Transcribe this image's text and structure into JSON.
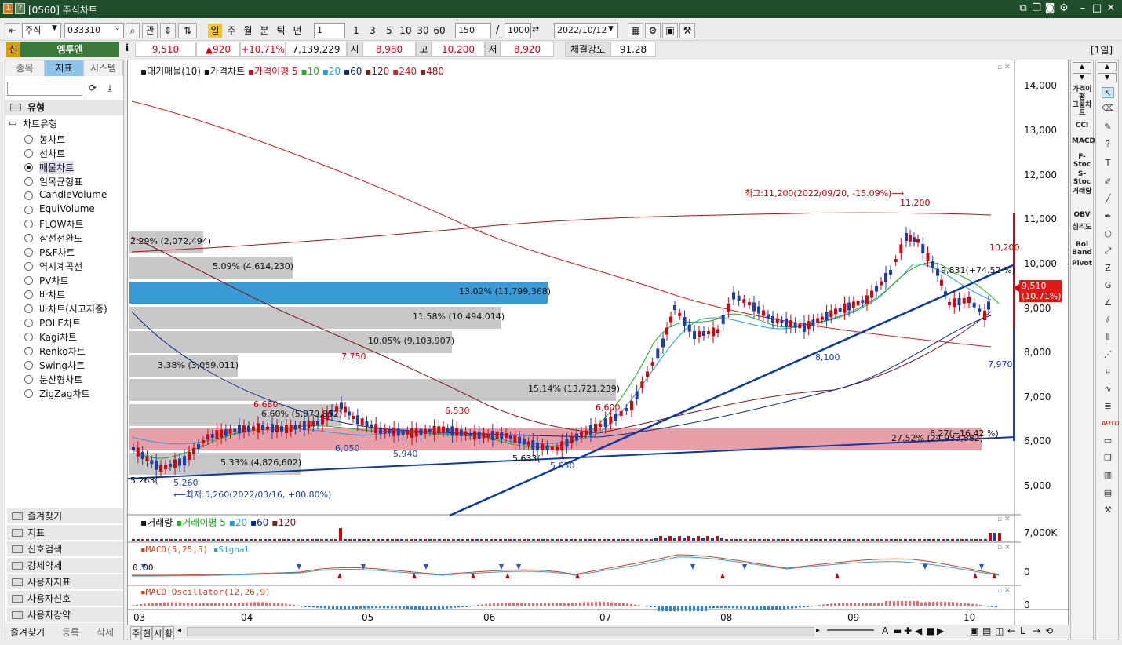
{
  "window": {
    "title": "[0560] 주식차트",
    "icons": [
      "1",
      "?"
    ]
  },
  "toolbar": {
    "market": "주식",
    "code": "033310",
    "related_btn": "관",
    "periods": [
      "일",
      "주",
      "월",
      "분",
      "틱",
      "년"
    ],
    "active_period": "일",
    "interval_select": "1",
    "minute_buttons": [
      "1",
      "3",
      "5",
      "10",
      "30",
      "60"
    ],
    "count": "150",
    "slash": "/",
    "max_count": "1000",
    "date": "2022/10/12"
  },
  "quote": {
    "flag": "신",
    "name": "엠투엔",
    "info_btn": "i",
    "price": "9,510",
    "change": "▲920",
    "rate": "+10.71%",
    "volume": "7,139,229",
    "open_label": "시",
    "open": "8,980",
    "high_label": "고",
    "high": "10,200",
    "low_label": "저",
    "low": "8,920",
    "strength_label": "체결강도",
    "strength": "91.28",
    "period_tag": "[1일]"
  },
  "left_panel": {
    "tabs": [
      "종목",
      "지표",
      "시스템"
    ],
    "active_tab": "지표",
    "section": "유형",
    "tree_root": "차트유형",
    "chart_types": [
      "봉차트",
      "선차트",
      "매물차트",
      "일목균형표",
      "CandleVolume",
      "EquiVolume",
      "FLOW차트",
      "삼선전환도",
      "P&F차트",
      "역시계곡선",
      "PV차트",
      "바차트",
      "바차트(시고저종)",
      "POLE차트",
      "Kagi차트",
      "Renko차트",
      "Swing차트",
      "분산형차트",
      "ZigZag차트"
    ],
    "selected_type": "매물차트",
    "groups": [
      "즐겨찾기",
      "지표",
      "신호검색",
      "강세약세",
      "사용자지표",
      "사용자신호",
      "사용자강약"
    ],
    "bottom_buttons": [
      "즐겨찾기",
      "등록",
      "삭제"
    ]
  },
  "chart": {
    "legend_main": {
      "vp": "대기매물(10)",
      "price": "가격차트",
      "ma_label": "가격이평 5",
      "ma": [
        "10",
        "20",
        "60",
        "120",
        "240",
        "480"
      ]
    },
    "y_labels": [
      "14,000",
      "13,000",
      "12,000",
      "11,000",
      "10,000",
      "9,000",
      "8,000",
      "7,000",
      "6,000",
      "5,000"
    ],
    "x_labels": [
      "03",
      "04",
      "05",
      "06",
      "07",
      "08",
      "09",
      "10"
    ],
    "volume_profile": [
      {
        "pct": "2.29% (2,072,494)"
      },
      {
        "pct": "5.09% (4,614,230)"
      },
      {
        "pct": "13.02% (11,799,368)"
      },
      {
        "pct": "11.58% (10,494,014)"
      },
      {
        "pct": "10.05% (9,103,907)"
      },
      {
        "pct": "3.38% (3,059,011)"
      },
      {
        "pct": "15.14% (13,721,239)"
      },
      {
        "pct": "6.60% (5,979,852)"
      },
      {
        "pct": "27.52% (24,933,882)"
      },
      {
        "pct": "5.33% (4,826,602)"
      }
    ],
    "annotations": {
      "high_note": "최고:11,200(2022/09/20, -15.09%)⟶",
      "low_note": "⟵최저:5,260(2022/03/16, +80.80%)",
      "p11200": "11,200",
      "p10200": "10,200",
      "p9831": "9,831(+74.52 %)",
      "p8100": "8,100",
      "p7970": "7,970",
      "p7750": "7,750",
      "p6680": "6,680",
      "p6530": "6,530",
      "p6600": "6,600",
      "p6050": "6,050",
      "p5940": "5,940",
      "p5633": "5,633(",
      "p5650": "5,650",
      "p5263": "5,263(",
      "p5260": "5,260",
      "p627": "6.27(+16.42 %)",
      "cur_price": "9,510",
      "cur_rate": "(10.71%)"
    },
    "volume_pane": {
      "legend_vol": "거래량",
      "legend_ma": "거래이평 5",
      "ma": [
        "20",
        "60",
        "120"
      ],
      "y": "7,000K"
    },
    "macd_pane": {
      "legend": "MACD(5,25,5)",
      "signal": "Signal",
      "left_val": "0.00",
      "y": "0"
    },
    "osc_pane": {
      "legend": "MACD Oscillator(12,26,9)",
      "y": "0"
    },
    "bottom_tabs": [
      "주",
      "현",
      "시",
      "황"
    ]
  },
  "indicators": [
    "가격이평",
    "그물차트",
    "CCI",
    "MACD",
    "F-Stoc",
    "S-Stoc",
    "거래량",
    "OBV",
    "심리도",
    "Bol Band",
    "Pivot"
  ],
  "colors": {
    "title_bg": "#1e4f2a",
    "up": "#d4000e",
    "down": "#1f3ea8",
    "vp_gray": "#c8c8c8",
    "vp_blue": "#3a9ad6",
    "vp_pink": "#e8a0a8"
  }
}
